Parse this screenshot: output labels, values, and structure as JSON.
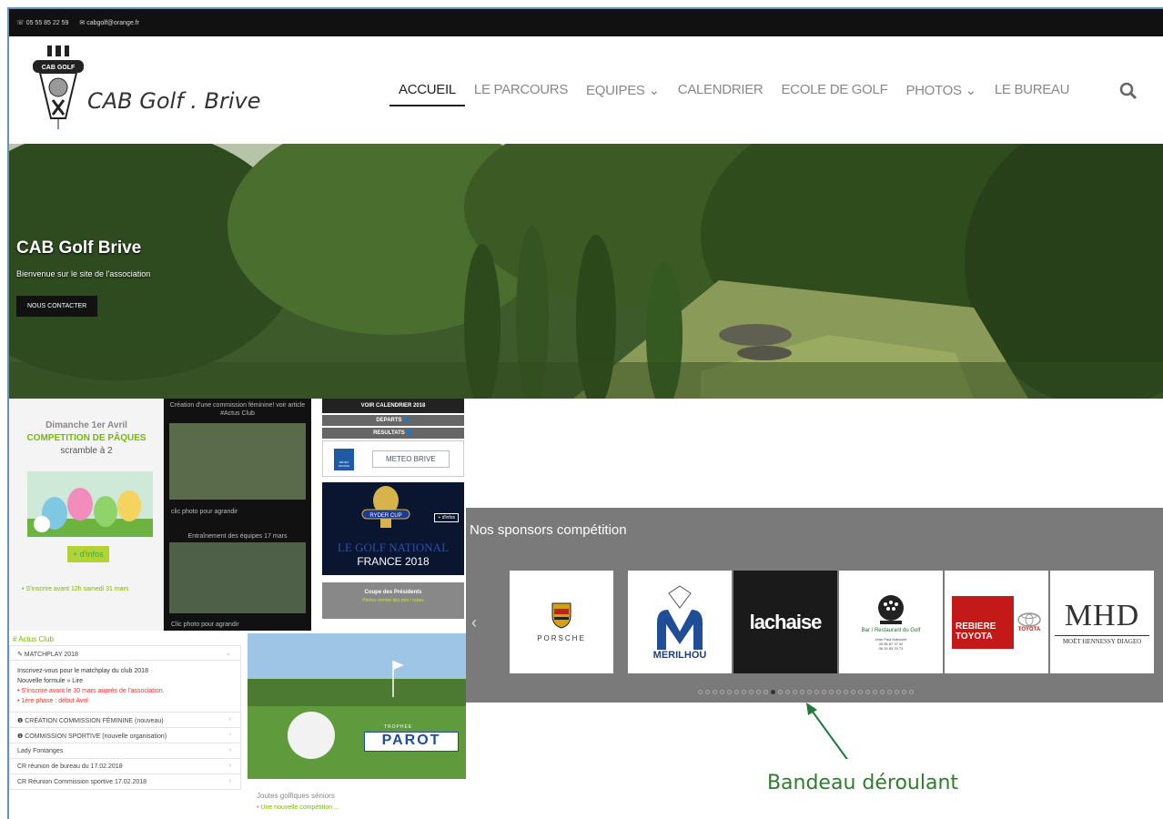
{
  "topbar": {
    "phone": "05 55 85 22 59",
    "email": "cabgolf@orange.fr"
  },
  "brand": {
    "logo_text": "CAB GOLF",
    "name": "CAB Golf . Brive"
  },
  "nav": {
    "items": [
      "ACCUEIL",
      "LE PARCOURS",
      "EQUIPES ⌄",
      "CALENDRIER",
      "ECOLE DE GOLF",
      "PHOTOS ⌄",
      "LE BUREAU"
    ],
    "active": "ACCUEIL"
  },
  "hero": {
    "title": "CAB Golf Brive",
    "subtitle": "Bienvenue sur le site de l'association",
    "button": "NOUS CONTACTER"
  },
  "promo": {
    "date": "Dimanche 1er Avril",
    "event": "COMPETITION DE PÂQUES",
    "format": "scramble à 2",
    "more": "+ d'infos",
    "deadline": "• S'inscrire avant 12h samedi 31 mars"
  },
  "gallery": {
    "caption1": "Création d'une commission féminine! voir article #Actus Club",
    "click1": "clic photo pour agrandir",
    "caption2": "Entraînement des équipes 17 mars",
    "click2": "Clic photo pour agrandir"
  },
  "quicklinks": {
    "calendar": "VOIR CALENDRIER 2018",
    "departs": "DEPARTS 👤",
    "results": "RESULTATS 👤",
    "meteo": "METEO BRIVE",
    "meteo_logo": "MÉTÉO FRANCE",
    "ryder_line1": "LE GOLF NATIONAL",
    "ryder_line2": "FRANCE 2018",
    "ryder_badge": "RYDER CUP",
    "ryder_more": "+ d'infos",
    "coupe_title": "Coupe des Présidents",
    "coupe_sub": "Photos remise des prix / repas"
  },
  "sponsors": {
    "title": "Nos sponsors compétition",
    "items": [
      "PORSCHE",
      "MERILHOU",
      "lachaise",
      "Bar / Restaurant du Golf",
      "REBIERE TOYOTA",
      "MHD"
    ],
    "extra": {
      "rebiere_group": "GROUPE",
      "toyota": "TOYOTA",
      "mhd_sub": "MOËT HENNESSY DIAGEO",
      "bar_owner": "Jean Paul Naboulet",
      "bar_tel1": "05 55 87 37 32",
      "bar_tel2": "06 15 83 79 73"
    },
    "dots_total": 30,
    "dots_active": 10
  },
  "accordion": {
    "header": "# Actus Club",
    "open_title": "✎ MATCHPLAY 2018",
    "open_line1": "Inscrivez-vous pour le matchplay du club 2018",
    "open_line2": "Nouvelle formule » Lire",
    "open_line3": "• S'inscrire avant le 30 mars auprès de l'association.",
    "open_line4": "• 1ère phase : début Avril",
    "items": [
      "❶ CRÉATION COMMISSION FÉMININE (nouveau)",
      "❶ COMMISSION SPORTIVE (nouvelle organisation)",
      "Lady Fontanges",
      "CR réunion de bureau du 17.02.2018",
      "CR Réunion Commission sportive 17.02.2018"
    ]
  },
  "golfcard": {
    "badge_top": "TROPHÉE",
    "badge": "PAROT",
    "caption": "Joutes golfiques séniors",
    "sub": "• Une nouvelle compétition ..."
  },
  "annotation": {
    "label": "Bandeau déroulant"
  }
}
